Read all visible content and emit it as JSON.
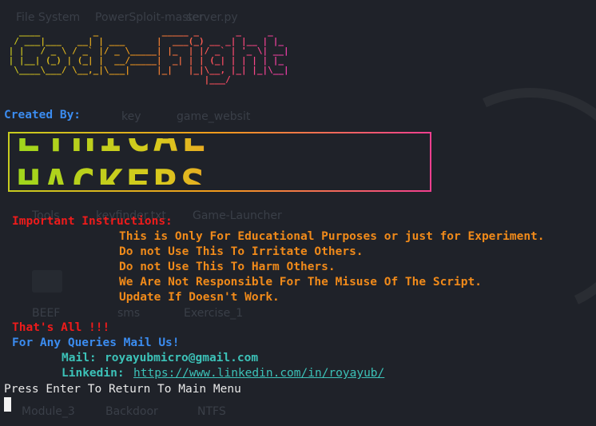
{
  "desktop": {
    "icons": [
      "File System",
      "PowerSploit-master",
      "server.py",
      "key",
      "game_websit",
      "Tools",
      "keyfinder.txt",
      "Game-Launcher",
      "BEEF",
      "sms",
      "Exercise_1",
      "Module_3",
      "Backdoor",
      "NTFS"
    ]
  },
  "banner": {
    "title_ascii": "   ____          _            _____ _       _     _   \n  / ___|___   __| | ___      |  ___(_) __ _| |__ | |_ \n | |   / _ \\ / _` |/ _ \\_____| |_  | |/ _` | '_ \\| __|\n | |__| (_) | (_| |  __/_____|  _| | | (_| | | | | |_ \n  \\____\\___/ \\__,_|\\___|     |_|   |_|\\__, |_| |_|\\__|\n                                      |___/           ",
    "created_by_label": "Created By:",
    "team_name": "ETHICAL HACKERS"
  },
  "instructions": {
    "heading": "Important Instructions:",
    "lines": [
      "This is Only For Educational Purposes or just for Experiment.",
      "Do not Use This To Irritate Others.",
      "Do not Use This To Harm Others.",
      "We Are Not Responsible For The Misuse Of The Script.",
      "Update If Doesn't Work."
    ]
  },
  "footer": {
    "thats_all": "That's All !!!",
    "queries": "For Any Queries Mail Us!",
    "mail_label": "Mail:",
    "mail_value": "royayubmicro@gmail.com",
    "linkedin_label": "Linkedin:",
    "linkedin_value": "https://www.linkedin.com/in/royayub/"
  },
  "prompt": "Press Enter To Return To Main Menu"
}
